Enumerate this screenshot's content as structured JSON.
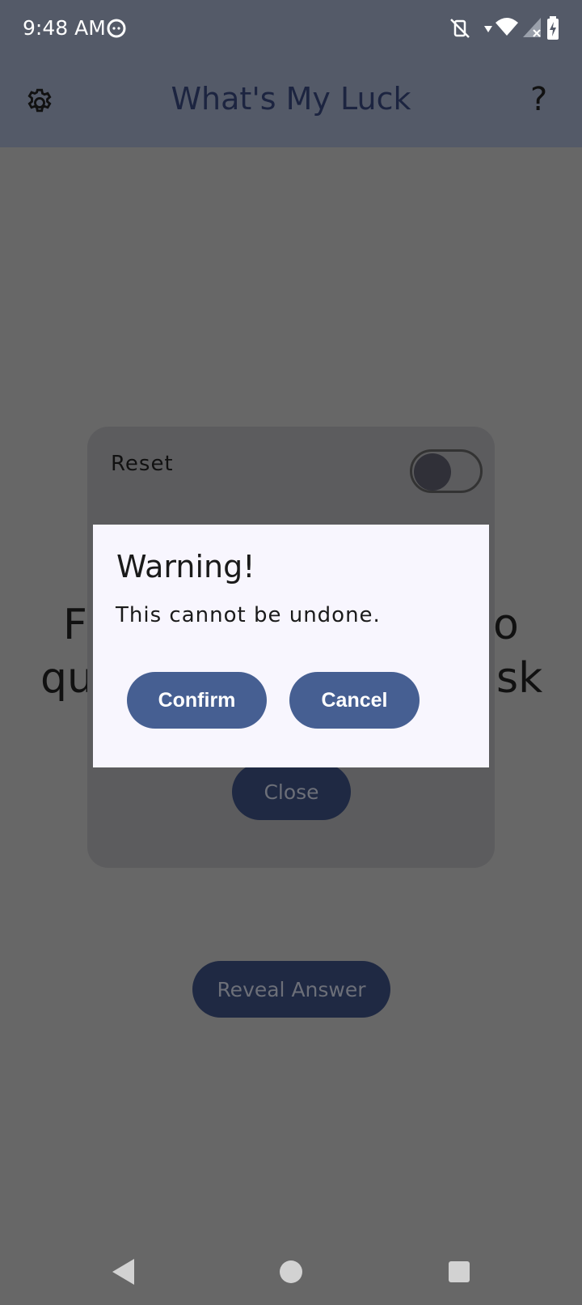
{
  "status_bar": {
    "time": "9:48 AM"
  },
  "app_bar": {
    "title": "What's My Luck",
    "help_label": "?"
  },
  "background": {
    "question_text": [
      "Fo",
      "qu sk"
    ],
    "line1_left": "F",
    "line1_right": "o",
    "line2_left": "qu",
    "line2_right": "sk",
    "reveal_button": "Reveal Answer"
  },
  "settings_sheet": {
    "reset_label": "Reset",
    "reset_on": false,
    "close_button": "Close"
  },
  "dialog": {
    "title": "Warning!",
    "message": "This cannot be undone.",
    "confirm": "Confirm",
    "cancel": "Cancel"
  },
  "colors": {
    "dialog_button": "#465f92",
    "dim_overlay": "#676767"
  }
}
